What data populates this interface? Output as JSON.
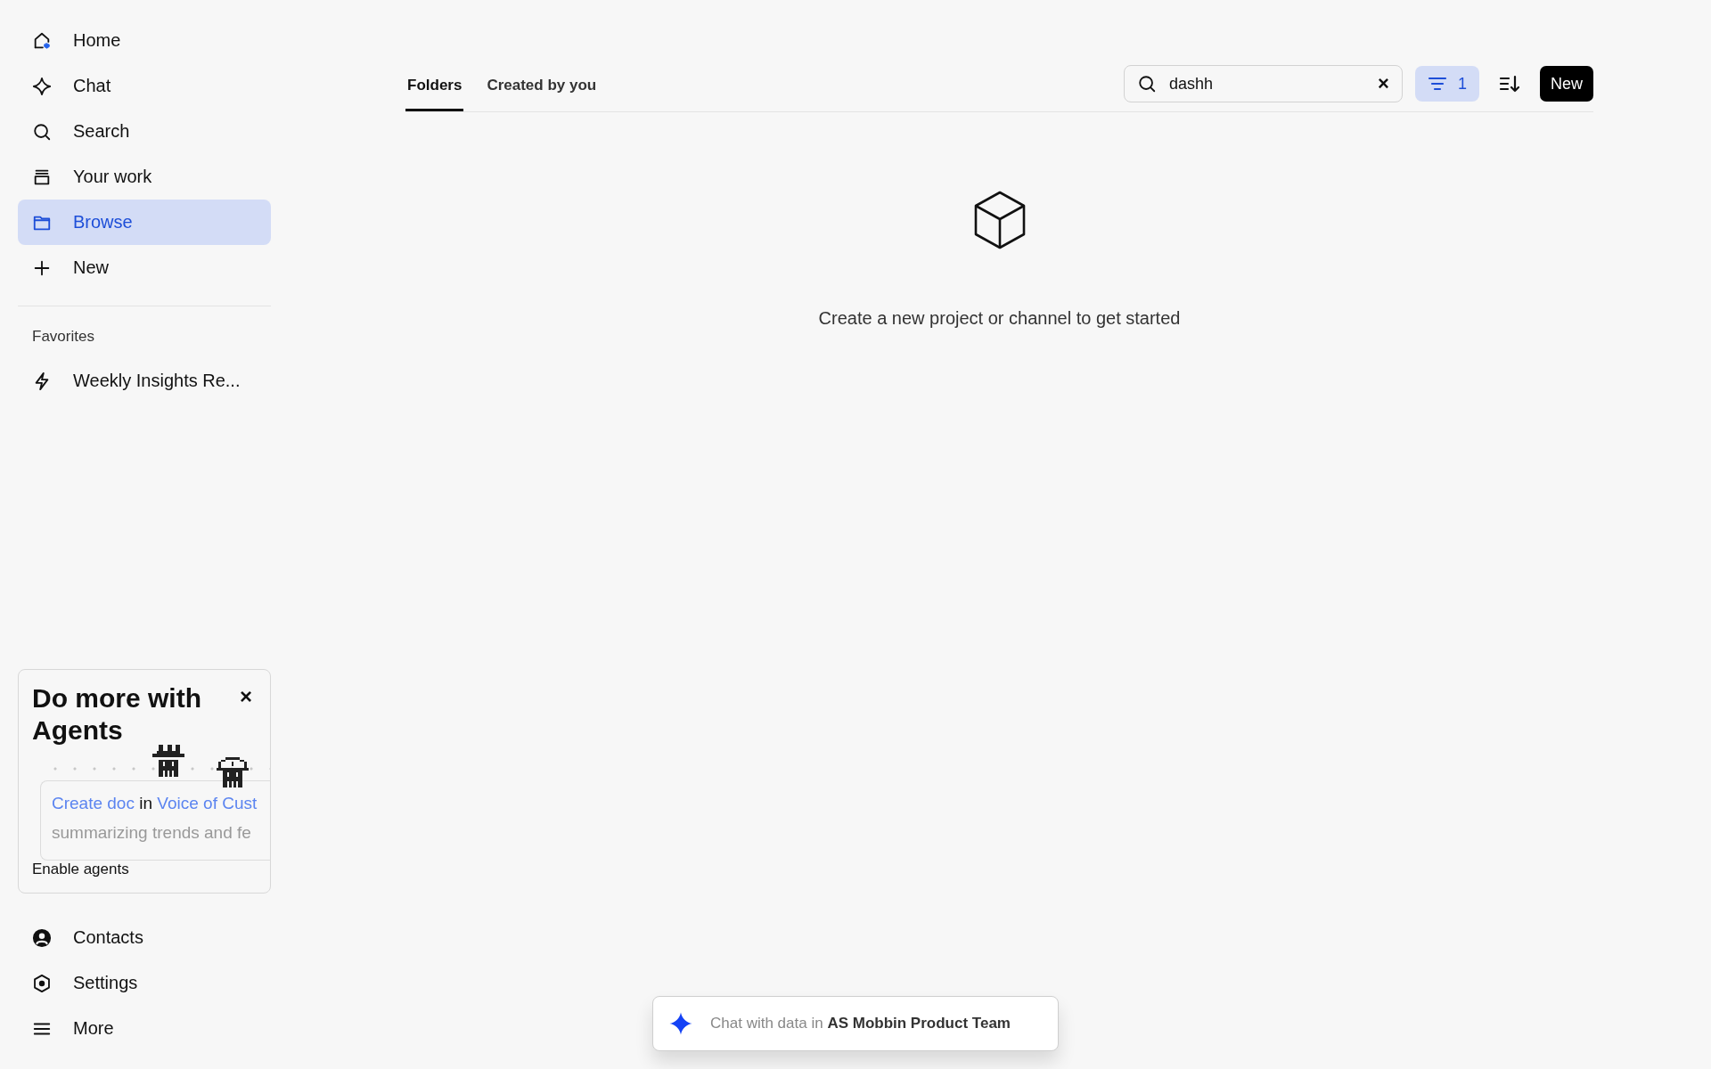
{
  "sidebar": {
    "nav": [
      {
        "kind": "home",
        "label": "Home",
        "selected": false
      },
      {
        "kind": "chat",
        "label": "Chat",
        "selected": false
      },
      {
        "kind": "search",
        "label": "Search",
        "selected": false
      },
      {
        "kind": "work",
        "label": "Your work",
        "selected": false
      },
      {
        "kind": "browse",
        "label": "Browse",
        "selected": true
      },
      {
        "kind": "new",
        "label": "New",
        "selected": false
      }
    ],
    "favorites": {
      "heading": "Favorites",
      "items": [
        {
          "kind": "bolt",
          "label": "Weekly Insights Re..."
        }
      ]
    },
    "promo": {
      "title": "Do more with Agents",
      "close": "×",
      "preview": {
        "action": "Create doc",
        "joiner": "in",
        "target": "Voice of Cust",
        "detail": "summarizing trends and fe"
      },
      "cta": "Enable agents"
    },
    "bottom_nav": [
      {
        "kind": "contacts",
        "label": "Contacts"
      },
      {
        "kind": "settings",
        "label": "Settings"
      },
      {
        "kind": "more",
        "label": "More"
      }
    ]
  },
  "tabs": [
    {
      "label": "Folders",
      "selected": true
    },
    {
      "label": "Created by you",
      "selected": false
    }
  ],
  "search": {
    "value": "dashh",
    "clear": "×"
  },
  "filter": {
    "count": "1"
  },
  "new_button": "New",
  "empty_state": {
    "message": "Create a new project or channel to get started"
  },
  "chat_bar": {
    "prefix": "Chat with data in",
    "team": "AS Mobbin Product Team"
  }
}
